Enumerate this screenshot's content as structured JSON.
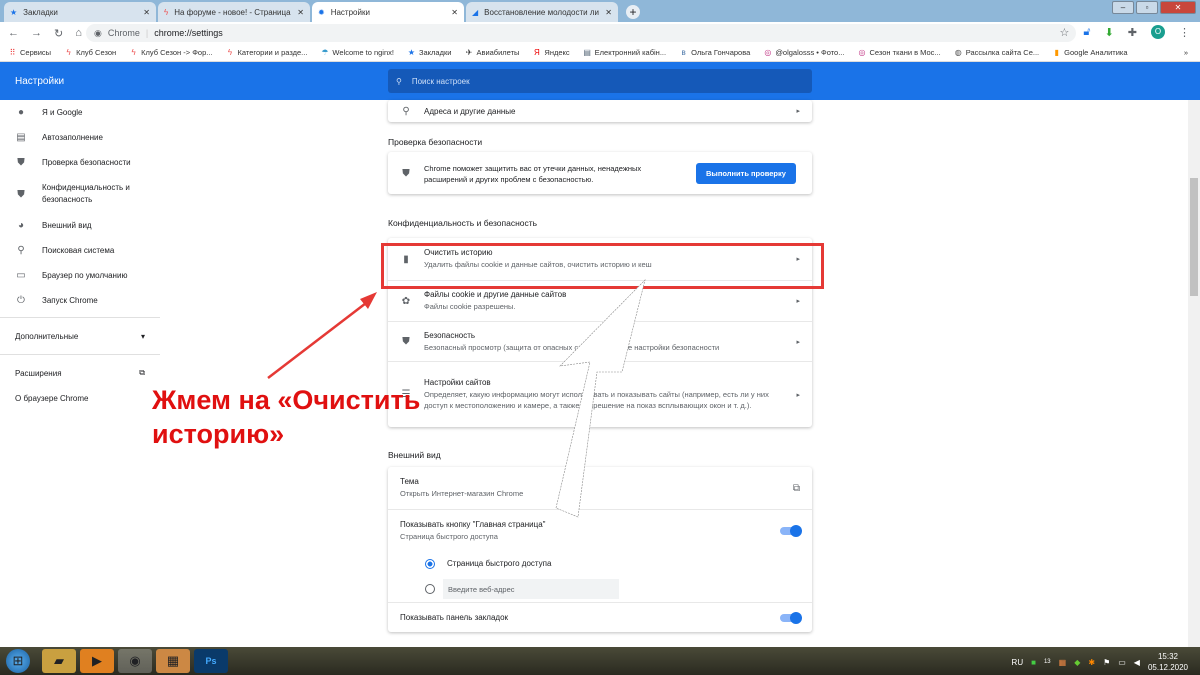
{
  "tabs": [
    {
      "label": "Закладки",
      "icon": "star-icon"
    },
    {
      "label": "На форуме - новое! - Страница",
      "icon": "forum-icon"
    },
    {
      "label": "Настройки",
      "icon": "gear-icon",
      "active": true
    },
    {
      "label": "Восстановление молодости ли...",
      "icon": "site-icon"
    }
  ],
  "address": {
    "site": "Chrome",
    "url": "chrome://settings"
  },
  "bookmarks": [
    "Сервисы",
    "Клуб Сезон",
    "Клуб Сезон -> Фор...",
    "Категории и разде...",
    "Welcome to nginx!",
    "Закладки",
    "Авиабилеты",
    "Яндекс",
    "Електронний кабін...",
    "Ольга Гончарова",
    "@olgalosss • Фото...",
    "Сезон ткани в Мос...",
    "Рассылка сайта Се...",
    "Google Аналитика"
  ],
  "avatar_letter": "O",
  "header": {
    "title": "Настройки",
    "search_placeholder": "Поиск настроек"
  },
  "sidebar": {
    "items": [
      "Я и Google",
      "Автозаполнение",
      "Проверка безопасности",
      "Конфиденциальность и безопасность",
      "Внешний вид",
      "Поисковая система",
      "Браузер по умолчанию",
      "Запуск Chrome"
    ],
    "advanced": "Дополнительные",
    "extensions": "Расширения",
    "about": "О браузере Chrome"
  },
  "main": {
    "addresses": "Адреса и другие данные",
    "safety_title": "Проверка безопасности",
    "safety_text": "Chrome поможет защитить вас от утечки данных, ненадежных расширений и других проблем с безопасностью.",
    "safety_button": "Выполнить проверку",
    "privacy_title": "Конфиденциальность и безопасность",
    "privacy_rows": [
      {
        "title": "Очистить историю",
        "sub": "Удалить файлы cookie и данные сайтов, очистить историю и кеш"
      },
      {
        "title": "Файлы cookie и другие данные сайтов",
        "sub": "Файлы cookie разрешены."
      },
      {
        "title": "Безопасность",
        "sub": "Безопасный просмотр (защита от опасных сайтов) и другие настройки безопасности"
      },
      {
        "title": "Настройки сайтов",
        "sub": "Определяет, какую информацию могут использовать и показывать сайты (например, есть ли у них доступ к местоположению и камере, а также разрешение на показ всплывающих окон и т. д.)."
      }
    ],
    "appearance_title": "Внешний вид",
    "theme": {
      "title": "Тема",
      "sub": "Открыть Интернет-магазин Chrome"
    },
    "home": {
      "title": "Показывать кнопку \"Главная страница\"",
      "sub": "Страница быстрого доступа",
      "enabled": true
    },
    "home_option1": "Страница быстрого доступа",
    "home_option2_placeholder": "Введите веб-адрес",
    "bookmarks_bar": {
      "title": "Показывать панель закладок",
      "enabled": true
    }
  },
  "annotation": "Жмем на «Очистить историю»",
  "taskbar": {
    "lang": "RU",
    "time": "15:32",
    "date": "05.12.2020",
    "badge": "13"
  }
}
